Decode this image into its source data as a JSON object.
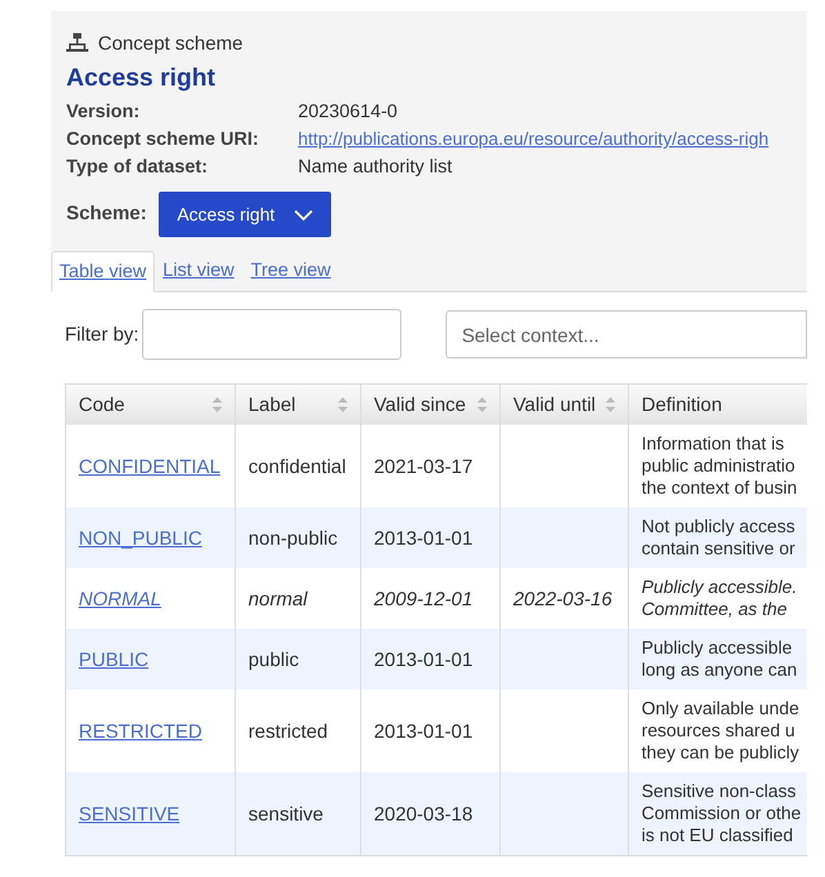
{
  "header": {
    "kind_label": "Concept scheme",
    "title": "Access right"
  },
  "properties": [
    {
      "label": "Version:",
      "value": "20230614-0",
      "kind": "text"
    },
    {
      "label": "Concept scheme URI:",
      "value": "http://publications.europa.eu/resource/authority/access-righ",
      "kind": "link"
    },
    {
      "label": "Type of dataset:",
      "value": "Name authority list",
      "kind": "text"
    }
  ],
  "scheme": {
    "label": "Scheme:",
    "value": "Access right"
  },
  "tabs": [
    {
      "label": "Table view",
      "selected": true
    },
    {
      "label": "List view",
      "selected": false
    },
    {
      "label": "Tree view",
      "selected": false
    }
  ],
  "filter": {
    "label": "Filter by:",
    "context_placeholder": "Select context..."
  },
  "table": {
    "columns": [
      {
        "label": "Code",
        "sortable": true
      },
      {
        "label": "Label",
        "sortable": true
      },
      {
        "label": "Valid since",
        "sortable": true
      },
      {
        "label": "Valid until",
        "sortable": true
      },
      {
        "label": "Definition",
        "sortable": false
      }
    ],
    "rows": [
      {
        "code": "CONFIDENTIAL",
        "label": "confidential",
        "valid_since": "2021-03-17",
        "valid_until": "",
        "definition": [
          "Information that is",
          "public administratio",
          "the context of busin"
        ],
        "deprecated": false
      },
      {
        "code": "NON_PUBLIC",
        "label": "non-public",
        "valid_since": "2013-01-01",
        "valid_until": "",
        "definition": [
          "Not publicly access",
          "contain sensitive or"
        ],
        "deprecated": false
      },
      {
        "code": "NORMAL",
        "label": "normal",
        "valid_since": "2009-12-01",
        "valid_until": "2022-03-16",
        "definition": [
          "Publicly accessible.",
          "Committee, as the"
        ],
        "deprecated": true
      },
      {
        "code": "PUBLIC",
        "label": "public",
        "valid_since": "2013-01-01",
        "valid_until": "",
        "definition": [
          "Publicly accessible",
          "long as anyone can"
        ],
        "deprecated": false
      },
      {
        "code": "RESTRICTED",
        "label": "restricted",
        "valid_since": "2013-01-01",
        "valid_until": "",
        "definition": [
          "Only available unde",
          "resources shared u",
          "they can be publicly"
        ],
        "deprecated": false
      },
      {
        "code": "SENSITIVE",
        "label": "sensitive",
        "valid_since": "2020-03-18",
        "valid_until": "",
        "definition": [
          "Sensitive non-class",
          "Commission or othe",
          "is not EU classified"
        ],
        "deprecated": false
      }
    ]
  }
}
